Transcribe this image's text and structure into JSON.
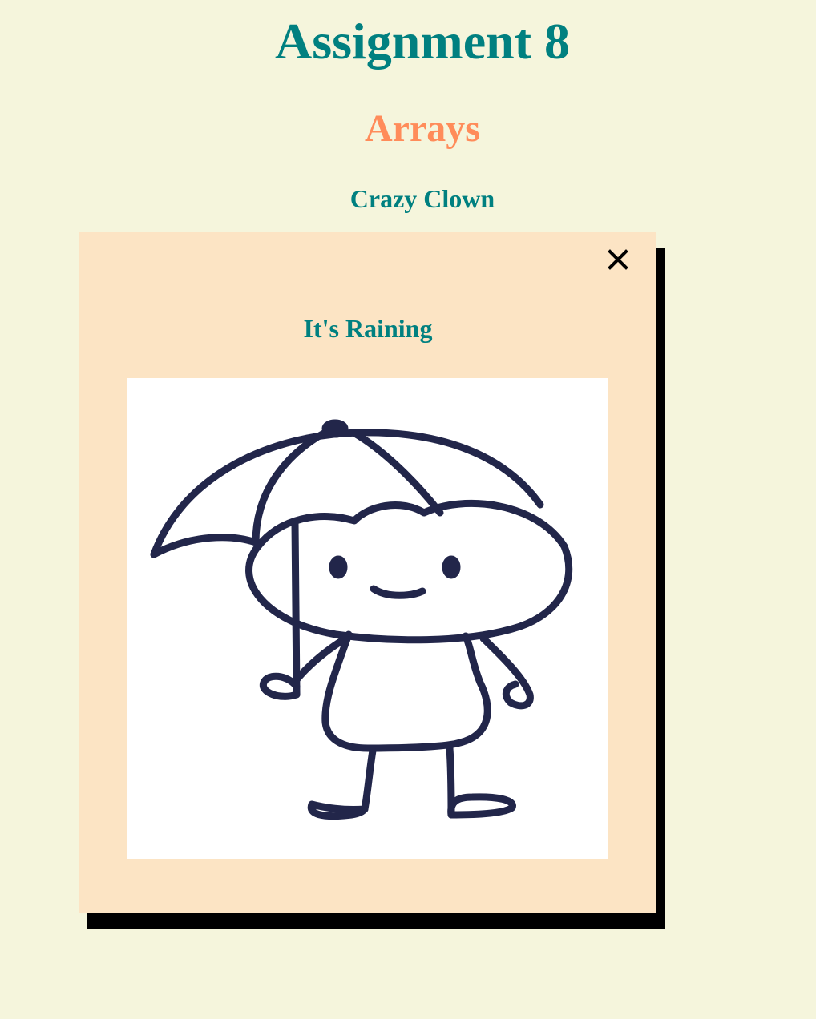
{
  "page": {
    "title": "Assignment 8",
    "subtitle": "Arrays",
    "section_title": "Crazy Clown"
  },
  "modal": {
    "title": "It's Raining",
    "close_icon": "close-icon",
    "image_icon": "stick-figure-umbrella-icon"
  },
  "colors": {
    "background": "#f5f5dc",
    "teal": "#008080",
    "coral": "#ff8c5a",
    "modal_background": "#fce4c4",
    "shadow": "#000000",
    "drawing_stroke": "#22264a"
  }
}
